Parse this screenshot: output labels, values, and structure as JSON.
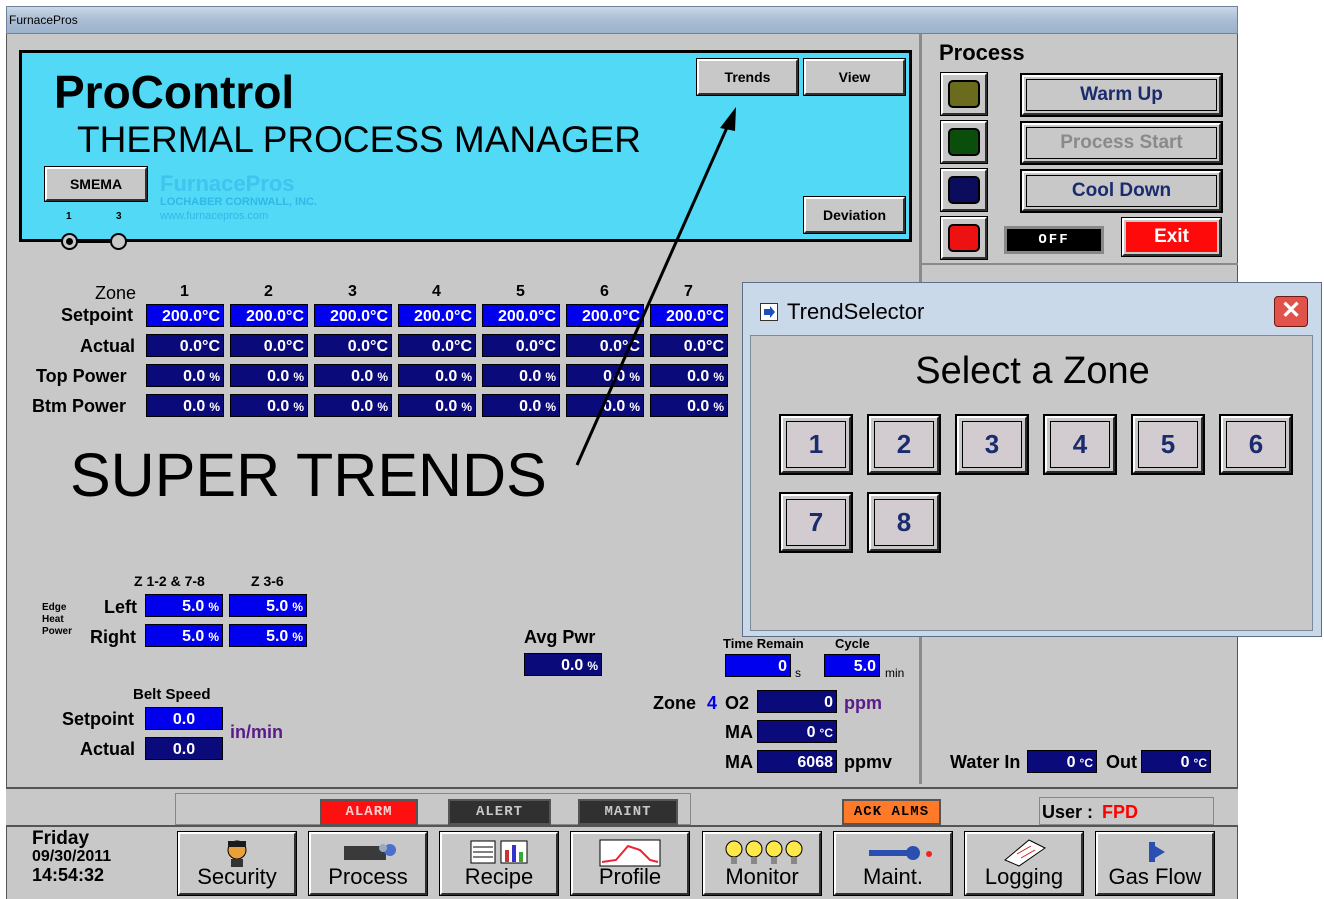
{
  "window": {
    "title": "FurnacePros"
  },
  "banner": {
    "title": "ProControl",
    "subtitle": "THERMAL PROCESS MANAGER",
    "brand": "FurnacePros",
    "brand_line2": "LOCHABER CORNWALL, INC.",
    "brand_line3": "www.furnacepros.com",
    "smema_label": "SMEMA",
    "trends_label": "Trends",
    "view_label": "View",
    "deviation_label": "Deviation",
    "radio1_label": "1",
    "radio3_label": "3"
  },
  "process": {
    "title": "Process",
    "warmup_label": "Warm Up",
    "start_label": "Process Start",
    "cooldown_label": "Cool Down",
    "exit_label": "Exit",
    "off_label": "OFF"
  },
  "zones": {
    "zone_label": "Zone",
    "setpoint_label": "Setpoint",
    "actual_label": "Actual",
    "top_power_label": "Top Power",
    "btm_power_label": "Btm Power",
    "numbers": [
      "1",
      "2",
      "3",
      "4",
      "5",
      "6",
      "7"
    ],
    "setpoints": [
      "200.0°C",
      "200.0°C",
      "200.0°C",
      "200.0°C",
      "200.0°C",
      "200.0°C",
      "200.0°C"
    ],
    "actuals": [
      "0.0°C",
      "0.0°C",
      "0.0°C",
      "0.0°C",
      "0.0°C",
      "0.0°C",
      "0.0°C"
    ],
    "top_power": [
      "0.0",
      "0.0",
      "0.0",
      "0.0",
      "0.0",
      "0.0",
      "0.0"
    ],
    "btm_power": [
      "0.0",
      "0.0",
      "0.0",
      "0.0",
      "0.0",
      "0.0",
      "0.0"
    ],
    "percent_unit": "%"
  },
  "annotation": {
    "text": "SUPER TRENDS"
  },
  "edge_heat": {
    "col1": "Z 1-2 & 7-8",
    "col2": "Z 3-6",
    "side_label": "Edge Heat Power",
    "left_label": "Left",
    "right_label": "Right",
    "left_values": [
      "5.0",
      "5.0"
    ],
    "right_values": [
      "5.0",
      "5.0"
    ]
  },
  "belt": {
    "title": "Belt Speed",
    "setpoint_label": "Setpoint",
    "actual_label": "Actual",
    "setpoint": "0.0",
    "actual": "0.0",
    "unit": "in/min"
  },
  "avg_pwr": {
    "label": "Avg Pwr",
    "value": "0.0"
  },
  "timing": {
    "remain_label": "Time Remain",
    "remain": "0",
    "remain_unit": "s",
    "cycle_label": "Cycle",
    "cycle": "5.0",
    "cycle_unit": "min"
  },
  "gas": {
    "zone_label": "Zone",
    "zone_num": "4",
    "o2_label": "O2",
    "o2_value": "0",
    "o2_unit": "ppm",
    "ma1_label": "MA",
    "ma1_value": "0",
    "ma1_unit": "°C",
    "ma2_label": "MA",
    "ma2_value": "6068",
    "ma2_unit": "ppmv"
  },
  "water": {
    "in_label": "Water In",
    "in_value": "0",
    "out_label": "Out",
    "out_value": "0",
    "unit": "°C"
  },
  "dialog": {
    "title": "TrendSelector",
    "heading": "Select a Zone",
    "zones": [
      "1",
      "2",
      "3",
      "4",
      "5",
      "6",
      "7",
      "8"
    ]
  },
  "status": {
    "alarm": "ALARM",
    "alert": "ALERT",
    "maint": "MAINT",
    "ack": "ACK ALMS",
    "user_label": "User :",
    "user": "FPD"
  },
  "clock": {
    "day": "Friday",
    "date": "09/30/2011",
    "time": "14:54:32"
  },
  "nav": [
    "Security",
    "Process",
    "Recipe",
    "Profile",
    "Monitor",
    "Maint.",
    "Logging",
    "Gas Flow"
  ],
  "colors": {
    "banner": "#52d9f5",
    "field": "#0000ee",
    "alarm": "#ff0000",
    "label_blue": "#1a2b6e"
  }
}
